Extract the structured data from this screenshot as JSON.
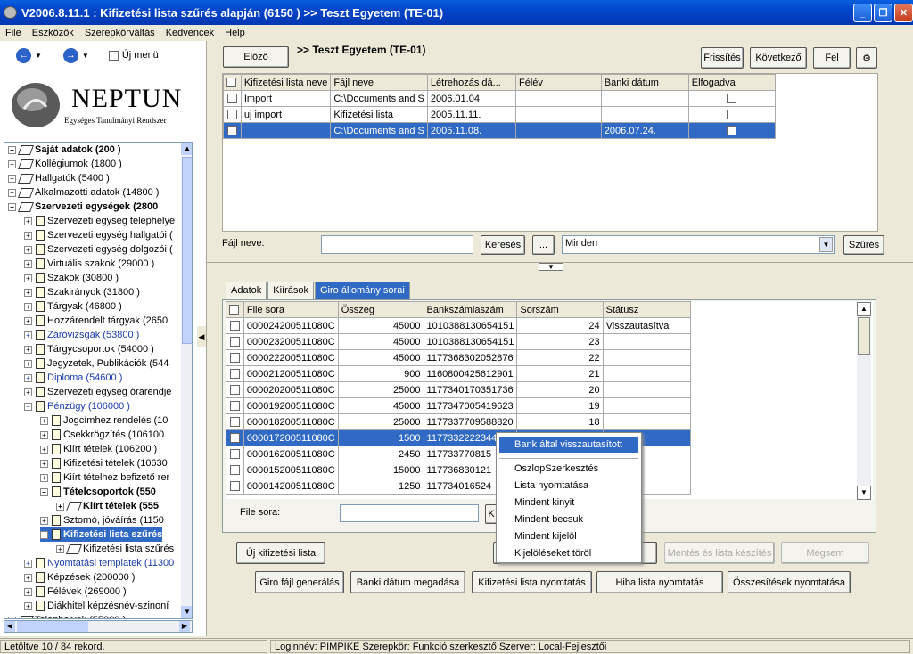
{
  "window": {
    "title": "V2006.8.11.1 : Kifizetési lista szűrés alapján (6150  )  >> Teszt Egyetem (TE-01)"
  },
  "menu": [
    "File",
    "Eszközök",
    "Szerepkörváltás",
    "Kedvencek",
    "Help"
  ],
  "nav": {
    "new_menu_label": "Új menü"
  },
  "logo": {
    "name": "NEPTUN",
    "subtitle": "Egységes Tanulmányi Rendszer"
  },
  "tree": [
    {
      "label": "Saját adatok (200  )",
      "level": 0,
      "style": "bold",
      "icon": "book"
    },
    {
      "label": "Kollégiumok (1800  )",
      "level": 0,
      "icon": "book"
    },
    {
      "label": "Hallgatók (5400  )",
      "level": 0,
      "icon": "book"
    },
    {
      "label": "Alkalmazotti adatok (14800  )",
      "level": 0,
      "icon": "book"
    },
    {
      "label": "Szervezeti egységek (2800",
      "level": 0,
      "style": "bold",
      "icon": "book",
      "expanded": true
    },
    {
      "label": "Szervezeti egység telephelye",
      "level": 1,
      "icon": "page"
    },
    {
      "label": "Szervezeti egység hallgatói (",
      "level": 1,
      "icon": "page"
    },
    {
      "label": "Szervezeti egység dolgozói (",
      "level": 1,
      "icon": "page"
    },
    {
      "label": "Virtuális szakok (29000  )",
      "level": 1,
      "icon": "page"
    },
    {
      "label": "Szakok (30800  )",
      "level": 1,
      "icon": "page"
    },
    {
      "label": "Szakirányok (31800  )",
      "level": 1,
      "icon": "page"
    },
    {
      "label": "Tárgyak (46800  )",
      "level": 1,
      "icon": "page"
    },
    {
      "label": "Hozzárendelt tárgyak (2650",
      "level": 1,
      "icon": "page"
    },
    {
      "label": "Záróvizsgák (53800  )",
      "level": 1,
      "style": "blue",
      "icon": "page"
    },
    {
      "label": "Tárgycsoportok (54000  )",
      "level": 1,
      "icon": "page"
    },
    {
      "label": "Jegyzetek, Publikációk (544",
      "level": 1,
      "icon": "page"
    },
    {
      "label": "Diploma (54600  )",
      "level": 1,
      "style": "blue",
      "icon": "page"
    },
    {
      "label": "Szervezeti egység órarendje",
      "level": 1,
      "icon": "page"
    },
    {
      "label": "Pénzügy (106000  )",
      "level": 1,
      "style": "blue",
      "icon": "page",
      "expanded": true
    },
    {
      "label": "Jogcímhez rendelés (10",
      "level": 2,
      "icon": "page"
    },
    {
      "label": "Csekkrögzítés (106100",
      "level": 2,
      "icon": "page"
    },
    {
      "label": "Kiírt tételek (106200  )",
      "level": 2,
      "icon": "page"
    },
    {
      "label": "Kifizetési tételek (10630",
      "level": 2,
      "icon": "page"
    },
    {
      "label": "Kiírt tételhez befizető rer",
      "level": 2,
      "icon": "page"
    },
    {
      "label": "Tételcsoportok (550",
      "level": 2,
      "style": "bold",
      "icon": "page",
      "expanded": true
    },
    {
      "label": "Kiírt tételek (555",
      "level": 3,
      "style": "bold",
      "icon": "book"
    },
    {
      "label": "Sztornó, jóváírás (1150",
      "level": 2,
      "icon": "page"
    },
    {
      "label": "Kifizetési lista szűrés",
      "level": 2,
      "style": "sel",
      "icon": "page",
      "expanded": true
    },
    {
      "label": "Kifizetési lista szűrés",
      "level": 3,
      "icon": "book"
    },
    {
      "label": "Nyomtatási templatek (11300",
      "level": 1,
      "style": "blue",
      "icon": "page"
    },
    {
      "label": "Képzések (200000  )",
      "level": 1,
      "icon": "page"
    },
    {
      "label": "Félévek (269000  )",
      "level": 1,
      "icon": "page"
    },
    {
      "label": "Diákhitel képzésnév-szinoní",
      "level": 1,
      "icon": "page"
    },
    {
      "label": "Telephelyek (55800  )",
      "level": 0,
      "icon": "book"
    }
  ],
  "header": {
    "prev_label": "Előző",
    "context": ">> Teszt Egyetem (TE-01)",
    "refresh_label": "Frissítés",
    "next_label": "Következő",
    "up_label": "Fel"
  },
  "top_grid": {
    "columns": [
      "",
      "Kifizetési lista neve",
      "Fájl neve",
      "Létrehozás dá...",
      "Félév",
      "Banki dátum",
      "Elfogadva"
    ],
    "rows": [
      [
        "",
        "Import",
        "C:\\Documents and S",
        "2006.01.04.",
        "",
        "",
        ""
      ],
      [
        "",
        "uj import",
        "Kifizetési lista",
        "2005.11.11.",
        "",
        "",
        ""
      ],
      [
        "",
        "",
        "C:\\Documents and S",
        "2005.11.08.",
        "",
        "2006.07.24.",
        ""
      ]
    ],
    "selected_row": 2
  },
  "filter": {
    "file_name_label": "Fájl neve:",
    "search_label": "Keresés",
    "browse_label": "...",
    "combo_value": "Minden",
    "filter_label": "Szűrés"
  },
  "tabs": [
    "Adatok",
    "Kiírások",
    "Giro állomány sorai"
  ],
  "active_tab": 2,
  "bottom_grid": {
    "columns": [
      "",
      "File sora",
      "Összeg",
      "Bankszámlaszám",
      "Sorszám",
      "Státusz"
    ],
    "rows": [
      [
        "",
        "000024200511080C",
        "45000",
        "1010388130654151",
        "24",
        "Visszautasítva"
      ],
      [
        "",
        "000023200511080C",
        "45000",
        "1010388130654151",
        "23",
        ""
      ],
      [
        "",
        "000022200511080C",
        "45000",
        "1177368302052876",
        "22",
        ""
      ],
      [
        "",
        "000021200511080C",
        "900",
        "1160800425612901",
        "21",
        ""
      ],
      [
        "",
        "000020200511080C",
        "25000",
        "1177340170351736",
        "20",
        ""
      ],
      [
        "",
        "000019200511080C",
        "45000",
        "1177347005419623",
        "19",
        ""
      ],
      [
        "",
        "000018200511080C",
        "25000",
        "1177337709588820",
        "18",
        ""
      ],
      [
        "",
        "000017200511080C",
        "1500",
        "1177332222344",
        "",
        ""
      ],
      [
        "",
        "000016200511080C",
        "2450",
        "117733770815",
        "",
        ""
      ],
      [
        "",
        "000015200511080C",
        "15000",
        "117736830121",
        "",
        ""
      ],
      [
        "",
        "000014200511080C",
        "1250",
        "117734016524",
        "",
        ""
      ]
    ],
    "selected_row": 7
  },
  "file_row_label": "File sora:",
  "context_menu": [
    "Bank által visszautasított",
    "OszlopSzerkesztés",
    "Lista nyomtatása",
    "Mindent kinyit",
    "Mindent becsuk",
    "Mindent kijelöl",
    "Kijelöléseket töröl"
  ],
  "actions": {
    "new_list": "Új kifizetési lista",
    "save_and_list": "Mentés és lista készítés",
    "cancel": "Mégsem",
    "giro": "Giro fájl generálás",
    "bank_date": "Banki dátum megadása",
    "print_list": "Kifizetési lista nyomtatás",
    "print_errors": "Hiba lista nyomtatás",
    "print_totals": "Összesítések nyomtatása"
  },
  "status": {
    "records": "Letöltve 10 / 84 rekord.",
    "login": "Loginnév: PIMPIKE  Szerepkör: Funkció szerkesztő  Szerver: Local-Fejlesztői"
  },
  "colors": {
    "selection": "#316ac5",
    "titlebar": "#0245c8",
    "face": "#ece9d8"
  }
}
